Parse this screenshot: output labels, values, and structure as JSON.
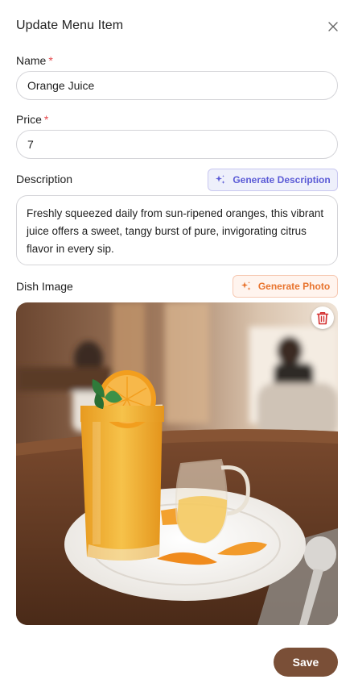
{
  "dialog": {
    "title": "Update Menu Item"
  },
  "fields": {
    "name": {
      "label": "Name",
      "required_mark": "*",
      "value": "Orange Juice"
    },
    "price": {
      "label": "Price",
      "required_mark": "*",
      "value": "7"
    },
    "description": {
      "label": "Description",
      "generate_label": "Generate Description",
      "value": "Freshly squeezed daily from sun-ripened oranges, this vibrant juice offers a sweet, tangy burst of pure, invigorating citrus flavor in every sip."
    },
    "image": {
      "label": "Dish Image",
      "generate_label": "Generate Photo"
    }
  },
  "actions": {
    "save_label": "Save"
  },
  "icons": {
    "close": "close-icon",
    "sparkle": "sparkle-icon",
    "delete": "trash-icon"
  },
  "colors": {
    "required": "#e5484d",
    "generate_description": "#5b5bd6",
    "generate_photo": "#e8742e",
    "save_button": "#7a4f37",
    "delete_icon": "#d32f2f"
  }
}
